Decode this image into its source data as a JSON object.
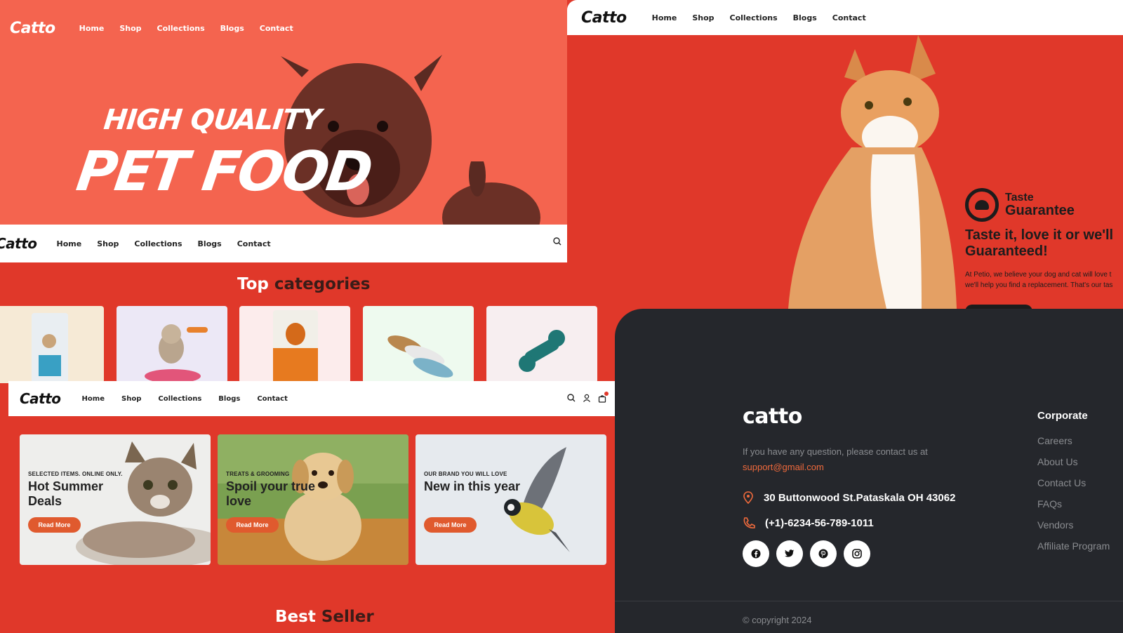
{
  "brand": {
    "logo": "Catto",
    "footer_logo": "catto"
  },
  "nav": {
    "home": "Home",
    "shop": "Shop",
    "collections": "Collections",
    "blogs": "Blogs",
    "contact": "Contact"
  },
  "hero": {
    "line1": "HIGH QUALITY",
    "line2": "PET FOOD"
  },
  "guarantee": {
    "badge_small": "Taste",
    "badge_big": "Guarantee",
    "heading_1": "Taste it, love it or we'll",
    "heading_2": "Guaranteed!",
    "body_1": "At Petio, we believe your dog and cat will love t",
    "body_2": "we'll help you find a replacement. That's our tas"
  },
  "categories": {
    "title_a": "Top",
    "title_b": "categories",
    "cards": [
      {
        "name": "cat-food-bag",
        "bg": "#f6ead6"
      },
      {
        "name": "cat-toy",
        "bg": "#ece8f6"
      },
      {
        "name": "nutrience-bag",
        "bg": "#fcecec"
      },
      {
        "name": "duck-toys",
        "bg": "#eefaef"
      },
      {
        "name": "bone-toy",
        "bg": "#f7eef0"
      }
    ]
  },
  "promos": [
    {
      "kicker": "SELECTED ITEMS. ONLINE ONLY.",
      "title": "Hot Summer Deals",
      "button": "Read More"
    },
    {
      "kicker": "TREATS & GROOMING",
      "title": "Spoil your true love",
      "button": "Read More"
    },
    {
      "kicker": "OUR BRAND YOU WILL LOVE",
      "title": "New in this year",
      "button": "Read More"
    }
  ],
  "best_seller": {
    "a": "Best",
    "b": "Seller"
  },
  "footer": {
    "question": "If you have any question, please contact us at",
    "email": "support@gmail.com",
    "address": "30 Buttonwood St.Pataskala OH 43062",
    "phone": "(+1)-6234-56-789-1011",
    "corporate_title": "Corporate",
    "corporate_links": [
      "Careers",
      "About Us",
      "Contact Us",
      "FAQs",
      "Vendors",
      "Affiliate Program"
    ],
    "copyright": "© copyright 2024"
  },
  "colors": {
    "accent": "#e0382a",
    "hero": "#f4644f",
    "footer_bg": "#25272c",
    "link": "#f06a3c"
  }
}
